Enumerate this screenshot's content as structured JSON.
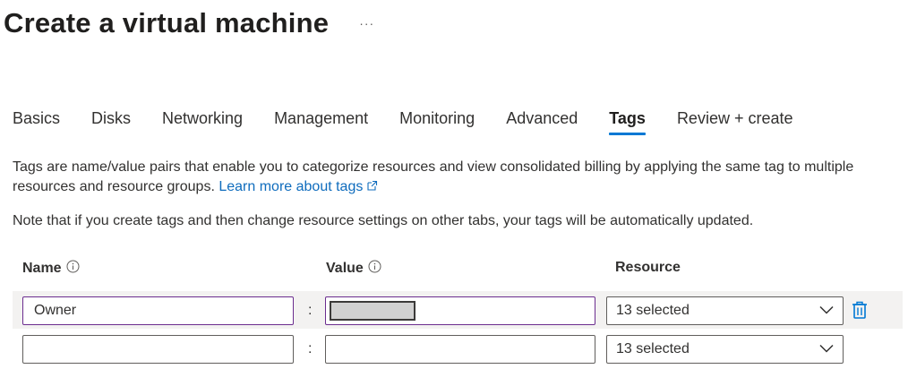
{
  "page": {
    "title": "Create a virtual machine",
    "more_label": "···"
  },
  "tabs": [
    {
      "label": "Basics"
    },
    {
      "label": "Disks"
    },
    {
      "label": "Networking"
    },
    {
      "label": "Management"
    },
    {
      "label": "Monitoring"
    },
    {
      "label": "Advanced"
    },
    {
      "label": "Tags",
      "active": true
    },
    {
      "label": "Review + create"
    }
  ],
  "description": {
    "text": "Tags are name/value pairs that enable you to categorize resources and view consolidated billing by applying the same tag to multiple resources and resource groups.",
    "link_text": "Learn more about tags"
  },
  "note": "Note that if you create tags and then change resource settings on other tabs, your tags will be automatically updated.",
  "table": {
    "headers": {
      "name": "Name",
      "value": "Value",
      "resource": "Resource"
    },
    "separator": ":",
    "rows": [
      {
        "name": "Owner",
        "value": "",
        "resource": "13 selected",
        "deletable": true
      },
      {
        "name": "",
        "value": "",
        "resource": "13 selected",
        "deletable": false
      }
    ]
  },
  "colors": {
    "accent": "#0078d4",
    "link": "#0f6cbd",
    "focus_border": "#6b2d8f",
    "row_highlight": "#f3f2f1"
  },
  "icons": {
    "more": "more-ellipsis-icon",
    "external_link": "external-link-icon",
    "info": "info-icon",
    "dropdown": "chevron-down-icon",
    "delete": "trash-icon"
  }
}
